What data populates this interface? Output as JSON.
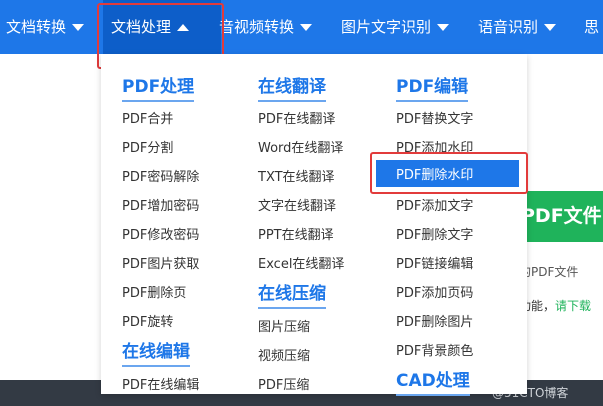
{
  "nav": {
    "items": [
      {
        "label": "文档转换",
        "caret": "down"
      },
      {
        "label": "文档处理",
        "caret": "up"
      },
      {
        "label": "音视频转换",
        "caret": "down"
      },
      {
        "label": "图片文字识别",
        "caret": "down"
      },
      {
        "label": "语音识别",
        "caret": "down"
      },
      {
        "label": "思",
        "caret": "none"
      }
    ]
  },
  "dropdown": {
    "columns": [
      {
        "groups": [
          {
            "title": "PDF处理",
            "items": [
              "PDF合并",
              "PDF分割",
              "PDF密码解除",
              "PDF增加密码",
              "PDF修改密码",
              "PDF图片获取",
              "PDF删除页",
              "PDF旋转"
            ]
          },
          {
            "title": "在线编辑",
            "items": [
              "PDF在线编辑"
            ]
          }
        ]
      },
      {
        "groups": [
          {
            "title": "在线翻译",
            "items": [
              "PDF在线翻译",
              "Word在线翻译",
              "TXT在线翻译",
              "文字在线翻译",
              "PPT在线翻译",
              "Excel在线翻译"
            ]
          },
          {
            "title": "在线压缩",
            "items": [
              "图片压缩",
              "视频压缩",
              "PDF压缩"
            ]
          }
        ]
      },
      {
        "groups": [
          {
            "title": "PDF编辑",
            "items": [
              "PDF替换文字",
              "PDF添加水印",
              "PDF删除水印",
              "PDF添加文字",
              "PDF删除文字",
              "PDF链接编辑",
              "PDF添加页码",
              "PDF删除图片",
              "PDF背景颜色"
            ]
          },
          {
            "title": "CAD处理",
            "items": []
          }
        ]
      }
    ],
    "selected_item": "PDF删除水印"
  },
  "background": {
    "banner_text": "PDF文件",
    "line1": "的PDF文件",
    "line2_prefix": "功能，",
    "line2_link": "请下载"
  },
  "watermark": "@51CTO博客",
  "colors": {
    "nav_bg": "#1e77e8",
    "nav_active_bg": "#0d5ec9",
    "accent": "#1e77e8",
    "highlight_border": "#e23b3b",
    "banner_green": "#1fb35b"
  }
}
